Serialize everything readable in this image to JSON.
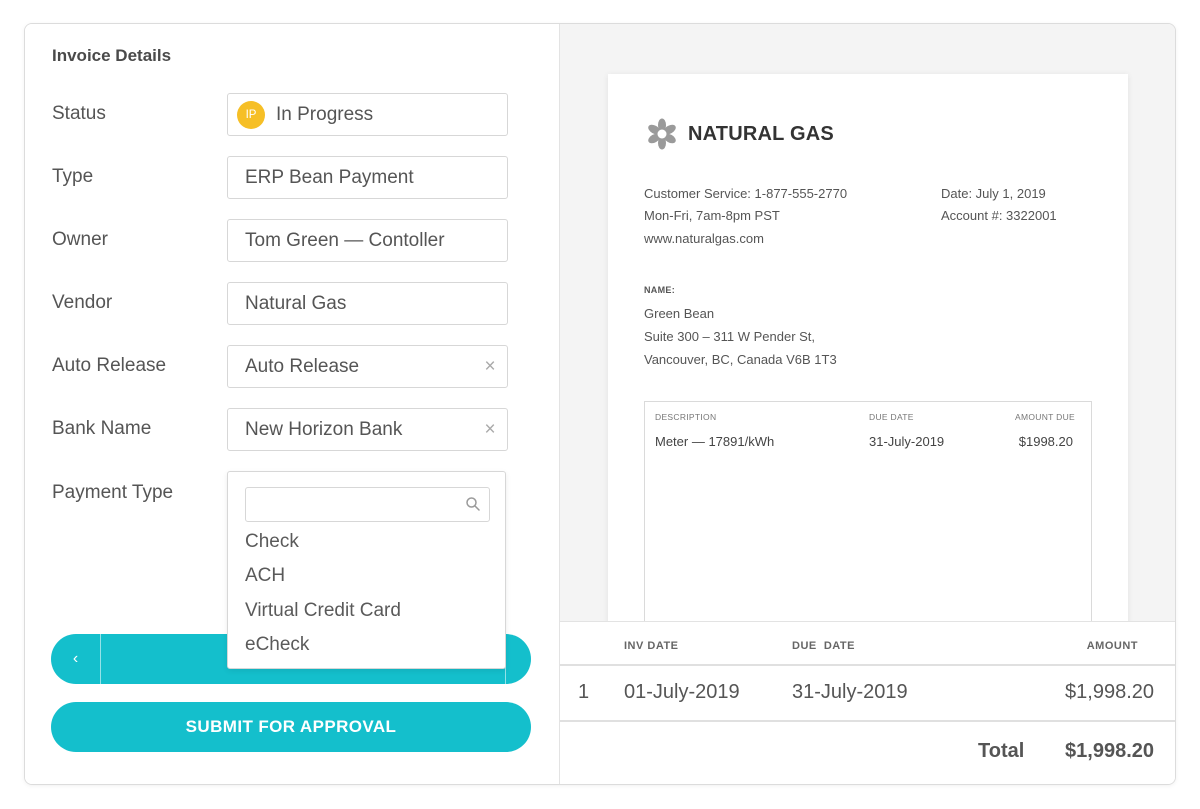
{
  "form": {
    "title": "Invoice Details",
    "status": {
      "label": "Status",
      "badge": "IP",
      "value": "In Progress",
      "badge_color": "#f6bf26"
    },
    "type": {
      "label": "Type",
      "value": "ERP Bean Payment"
    },
    "owner": {
      "label": "Owner",
      "value": "Tom Green — Contoller"
    },
    "vendor": {
      "label": "Vendor",
      "value": "Natural Gas"
    },
    "auto_release": {
      "label": "Auto Release",
      "value": "Auto Release",
      "clear_icon": "×"
    },
    "bank_name": {
      "label": "Bank Name",
      "value": "New Horizon Bank",
      "clear_icon": "×"
    },
    "payment_type": {
      "label": "Payment Type",
      "search_value": "",
      "options": [
        "Check",
        "ACH",
        "Virtual Credit Card",
        "eCheck"
      ]
    },
    "nav": {
      "prev_icon": "‹"
    },
    "submit_label": "SUBMIT FOR APPROVAL",
    "accent_color": "#14bfcc"
  },
  "invoice": {
    "brand": {
      "name": "NATURAL GAS",
      "icon": "gear-flower-icon"
    },
    "contact": {
      "customer_service": "Customer Service: 1-877-555-2770",
      "hours": "Mon-Fri, 7am-8pm PST",
      "website": "www.naturalgas.com"
    },
    "meta": {
      "date": "Date: July 1, 2019",
      "account": "Account #: 3322001"
    },
    "name_label": "NAME:",
    "customer": {
      "name": "Green Bean",
      "address1": "Suite 300 – 311 W Pender St,",
      "address2": "Vancouver, BC, Canada V6B 1T3"
    },
    "line_table": {
      "headers": {
        "description": "DESCRIPTION",
        "due_date": "DUE DATE",
        "amount_due": "AMOUNT DUE"
      },
      "rows": [
        {
          "description": "Meter — 17891/kWh",
          "due_date": "31-July-2019",
          "amount_due": "$1998.20"
        }
      ]
    }
  },
  "summary": {
    "headers": {
      "inv_date": "INV DATE",
      "due_date": "DUE  DATE",
      "amount": "AMOUNT"
    },
    "rows": [
      {
        "index": "1",
        "inv_date": "01-July-2019",
        "due_date": "31-July-2019",
        "amount": "$1,998.20"
      }
    ],
    "total_label": "Total",
    "total_value": "$1,998.20"
  }
}
